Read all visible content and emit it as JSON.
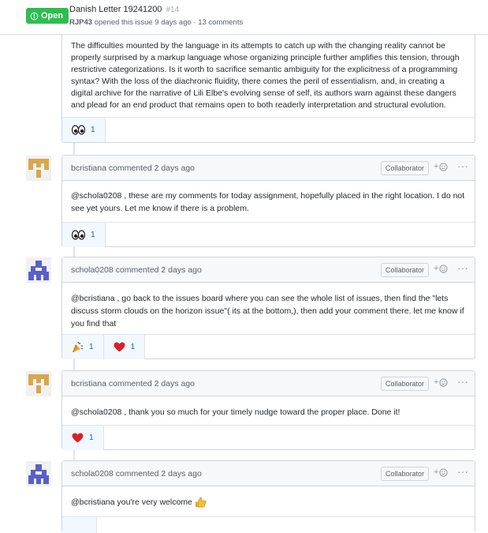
{
  "issue": {
    "state": "Open",
    "title": "Danish Letter 19241200",
    "number": "#14",
    "author": "RJP43",
    "meta_text": " opened this issue 9 days ago · 13 comments"
  },
  "colors": {
    "open_green": "#2cbe4e",
    "link_blue": "#0366d6",
    "border": "#d1d5da",
    "header_bg": "#f6f8fa"
  },
  "first_comment": {
    "body": "The difficulties mounted by the language in its attempts to catch up with the changing reality cannot be properly surprised by a markup language whose organizing principle further amplifies this tension, through restrictive categorizations. Is it worth to sacrifice semantic ambiguity for the explicitness of a programming syntax? With the loss of the diachronic fluidity, there comes the peril of essentialism, and, in creating a digital archive for the narrative of Lili Elbe's evolving sense of self, its authors warn against these dangers and plead for an end product that remains open to both readerly interpretation and structural evolution.",
    "reactions": [
      {
        "icon": "eyes-icon",
        "count": "1"
      }
    ]
  },
  "comments": [
    {
      "author": "bcristiana",
      "when": " commented 2 days ago",
      "role": "Collaborator",
      "mention": "@schola0208",
      "text": " , these are my comments for today assignment, hopefully placed in the right location. I do not see yet yours. Let me know if there is a problem.",
      "reactions": [
        {
          "icon": "eyes-icon",
          "count": "1"
        }
      ]
    },
    {
      "author": "schola0208",
      "when": " commented 2 days ago",
      "role": "Collaborator",
      "mention": "@bcristiana",
      "text": " , go back to the issues board where you can see the whole list of issues, then find the \"lets discuss storm clouds on the horizon issue\"( its at the bottom,), then add your comment there. let me know if you find that",
      "reactions": [
        {
          "icon": "tada-icon",
          "count": "1"
        },
        {
          "icon": "heart-icon",
          "count": "1"
        }
      ]
    },
    {
      "author": "bcristiana",
      "when": " commented 2 days ago",
      "role": "Collaborator",
      "mention": "@schola0208",
      "text": " , thank you so much for your timely nudge toward the proper place. Done it!",
      "reactions": [
        {
          "icon": "heart-icon",
          "count": "1"
        }
      ]
    },
    {
      "author": "schola0208",
      "when": " commented 2 days ago",
      "role": "Collaborator",
      "mention": "@bcristiana",
      "text": " you're very welcome",
      "reactions": []
    }
  ]
}
